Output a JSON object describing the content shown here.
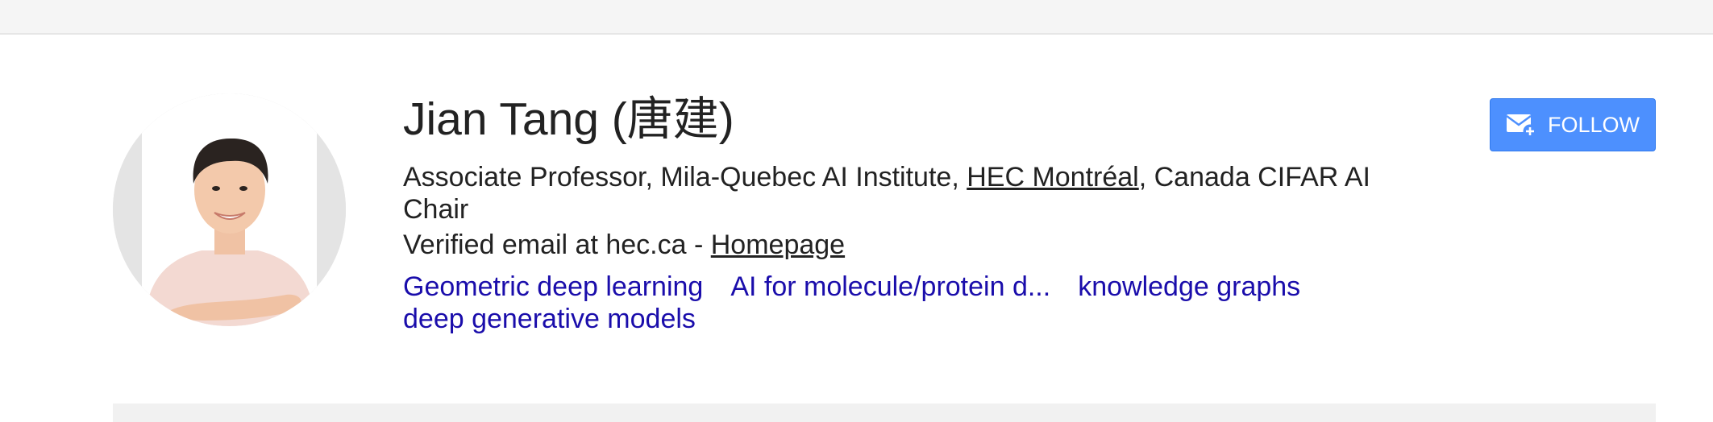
{
  "profile": {
    "name": "Jian Tang (唐建)",
    "affiliation_prefix": "Associate Professor, Mila-Quebec AI Institute, ",
    "affiliation_link": "HEC Montréal",
    "affiliation_suffix": ", Canada CIFAR AI Chair",
    "email_text": "Verified email at hec.ca - ",
    "homepage_label": "Homepage",
    "topics": [
      "Geometric deep learning",
      "AI for molecule/protein d...",
      "knowledge graphs",
      "deep generative models"
    ]
  },
  "actions": {
    "follow_label": "FOLLOW"
  },
  "colors": {
    "follow_button": "#4d90fe",
    "topic_link": "#1a0dab",
    "text": "#222222"
  }
}
